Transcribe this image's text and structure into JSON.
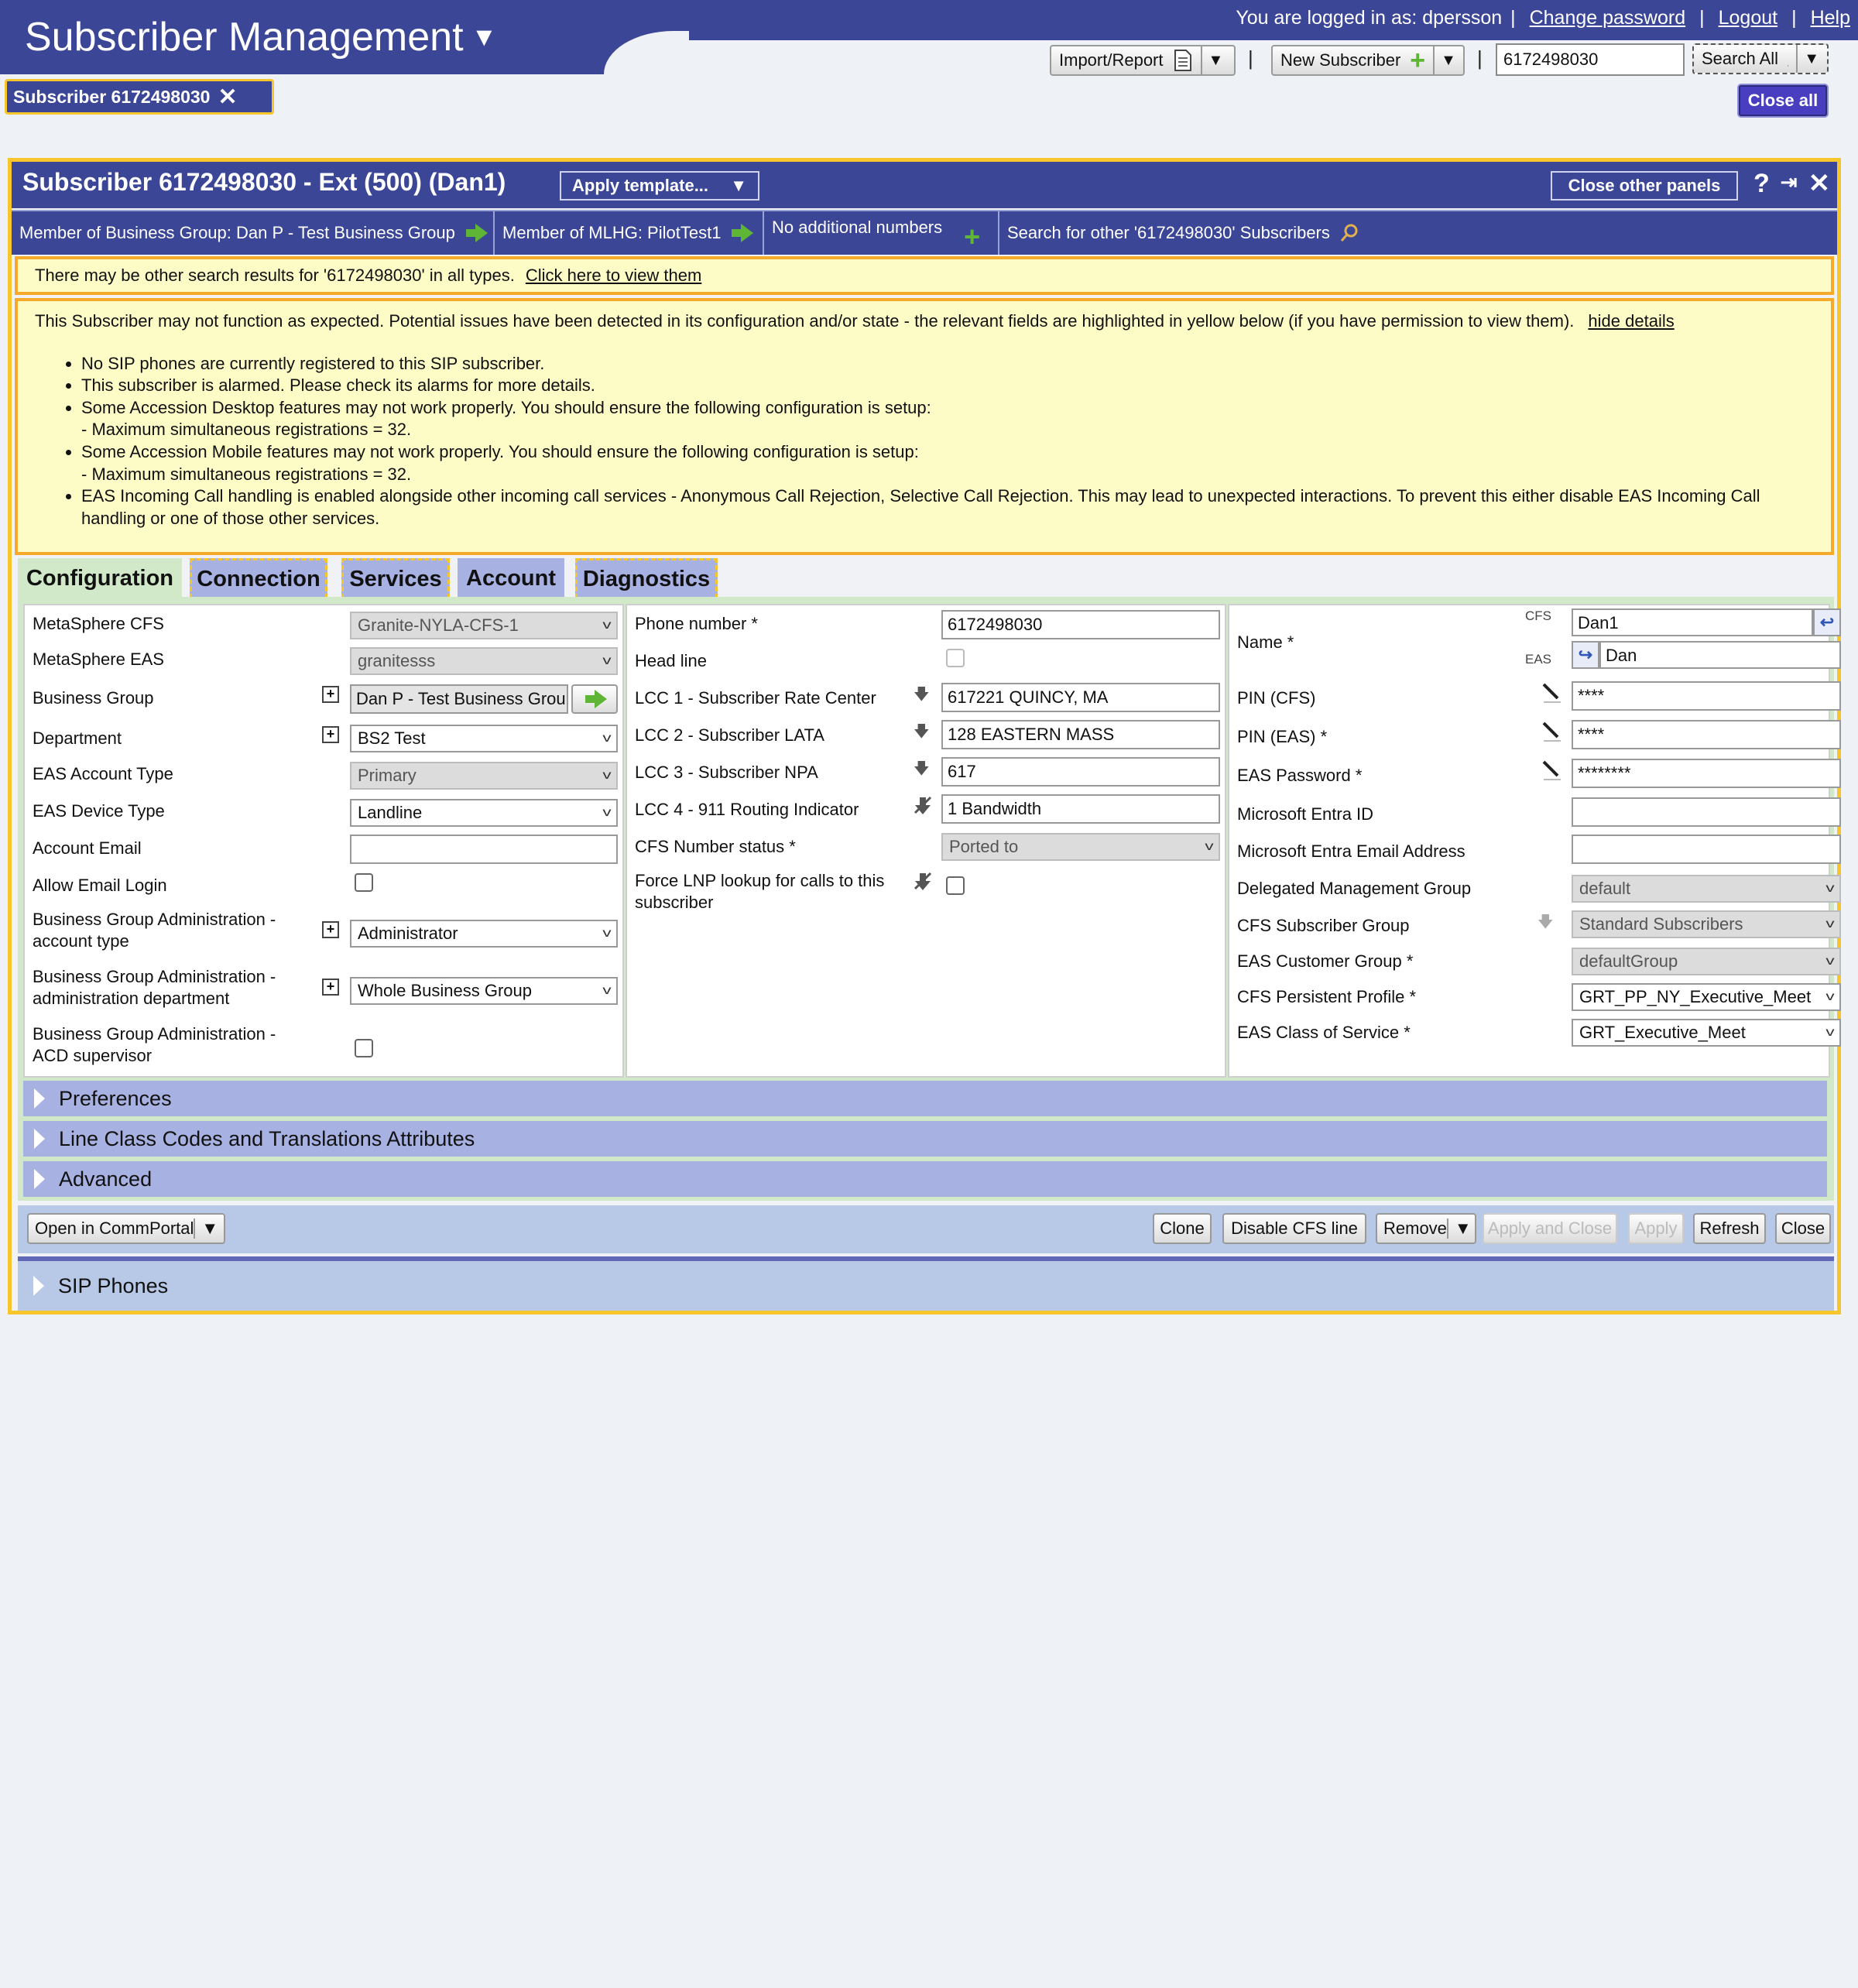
{
  "header": {
    "app_title": "Subscriber Management",
    "user_prefix": "You are logged in as:",
    "username": "dpersson",
    "change_password": "Change password",
    "logout": "Logout",
    "help": "Help"
  },
  "toolbar": {
    "import_report": "Import/Report",
    "new_subscriber": "New Subscriber",
    "search_value": "6172498030",
    "search_all": "Search All",
    "close_all": "Close all"
  },
  "open_tab": {
    "label": "Subscriber 6172498030"
  },
  "panel": {
    "title": "Subscriber 6172498030 - Ext (500) (Dan1)",
    "apply_template": "Apply template...",
    "close_other_panels": "Close other panels",
    "member_business_group": "Member of Business Group: Dan P - Test Business Group",
    "member_mlhg": "Member of MLHG: PilotTest1",
    "additional_numbers": "No additional numbers",
    "search_other": "Search for other '6172498030' Subscribers"
  },
  "notices": {
    "search_results": "There may be other search results for '6172498030' in all types.",
    "search_link": "Click here to view them",
    "warning_intro": "This Subscriber may not function as expected. Potential issues have been detected in its configuration and/or state - the relevant fields are highlighted in yellow below (if you have permission to view them).",
    "hide_details": "hide details",
    "items": [
      "No SIP phones are currently registered to this SIP subscriber.",
      "This subscriber is alarmed. Please check its alarms for more details.",
      "Some Accession Desktop features may not work properly. You should ensure the following configuration is setup:",
      "- Maximum simultaneous registrations = 32.",
      "Some Accession Mobile features may not work properly. You should ensure the following configuration is setup:",
      "- Maximum simultaneous registrations = 32.",
      "EAS Incoming Call handling is enabled alongside other incoming call services - Anonymous Call Rejection, Selective Call Rejection. This may lead to unexpected interactions. To prevent this either disable EAS Incoming Call handling or one of those other services."
    ]
  },
  "tabs": [
    "Configuration",
    "Connection",
    "Services",
    "Account",
    "Diagnostics"
  ],
  "col1": {
    "metasphere_cfs": {
      "label": "MetaSphere CFS",
      "value": "Granite-NYLA-CFS-1"
    },
    "metasphere_eas": {
      "label": "MetaSphere EAS",
      "value": "granitesss"
    },
    "business_group": {
      "label": "Business Group",
      "value": "Dan P - Test Business Group"
    },
    "department": {
      "label": "Department",
      "value": "BS2 Test"
    },
    "eas_account_type": {
      "label": "EAS Account Type",
      "value": "Primary"
    },
    "eas_device_type": {
      "label": "EAS Device Type",
      "value": "Landline"
    },
    "account_email": {
      "label": "Account Email",
      "value": ""
    },
    "allow_email_login": {
      "label": "Allow Email Login"
    },
    "bg_admin_account_type": {
      "label1": "Business Group Administration -",
      "label2": "account type",
      "value": "Administrator"
    },
    "bg_admin_department": {
      "label1": "Business Group Administration -",
      "label2": "administration department",
      "value": "Whole Business Group"
    },
    "bg_admin_acd": {
      "label1": "Business Group Administration -",
      "label2": "ACD supervisor"
    }
  },
  "col2": {
    "phone_number": {
      "label": "Phone number *",
      "value": "6172498030"
    },
    "head_line": {
      "label": "Head line"
    },
    "lcc1": {
      "label": "LCC 1 - Subscriber Rate Center",
      "value": "617221 QUINCY, MA"
    },
    "lcc2": {
      "label": "LCC 2 - Subscriber LATA",
      "value": "128 EASTERN MASS"
    },
    "lcc3": {
      "label": "LCC 3 - Subscriber NPA",
      "value": "617"
    },
    "lcc4": {
      "label": "LCC 4 - 911 Routing Indicator",
      "value": "1 Bandwidth"
    },
    "cfs_number_status": {
      "label": "CFS Number status *",
      "value": "Ported to"
    },
    "force_lnp": {
      "label1": "Force LNP lookup for calls to this",
      "label2": "subscriber"
    }
  },
  "col3": {
    "name": {
      "label": "Name *",
      "cfs_tag": "CFS",
      "eas_tag": "EAS",
      "cfs_value": "Dan1",
      "eas_value": "Dan"
    },
    "pin_cfs": {
      "label": "PIN (CFS)",
      "value": "****"
    },
    "pin_eas": {
      "label": "PIN (EAS) *",
      "value": "****"
    },
    "eas_password": {
      "label": "EAS Password *",
      "value": "********"
    },
    "entra_id": {
      "label": "Microsoft Entra ID",
      "value": ""
    },
    "entra_email": {
      "label": "Microsoft Entra Email Address",
      "value": ""
    },
    "delegated_group": {
      "label": "Delegated Management Group",
      "value": "default"
    },
    "cfs_subscriber_group": {
      "label": "CFS Subscriber Group",
      "value": "Standard Subscribers"
    },
    "eas_customer_group": {
      "label": "EAS Customer Group *",
      "value": "defaultGroup"
    },
    "cfs_persistent_profile": {
      "label": "CFS Persistent Profile *",
      "value": "GRT_PP_NY_Executive_Meeting"
    },
    "eas_class_of_service": {
      "label": "EAS Class of Service *",
      "value": "GRT_Executive_Meet"
    }
  },
  "accordions": [
    "Preferences",
    "Line Class Codes and Translations Attributes",
    "Advanced"
  ],
  "actions": {
    "open_commportal": "Open in CommPortal",
    "clone": "Clone",
    "disable_cfs_line": "Disable CFS line",
    "remove": "Remove",
    "apply_and_close": "Apply and Close",
    "apply": "Apply",
    "refresh": "Refresh",
    "close": "Close"
  },
  "sip_phones": "SIP Phones",
  "colors": {
    "brand": "#3c4696",
    "highlight": "#f7c62d",
    "warning_bg": "#fdfbc6",
    "tab_active": "#d2e9c9",
    "accordion": "#a8b2e2"
  }
}
